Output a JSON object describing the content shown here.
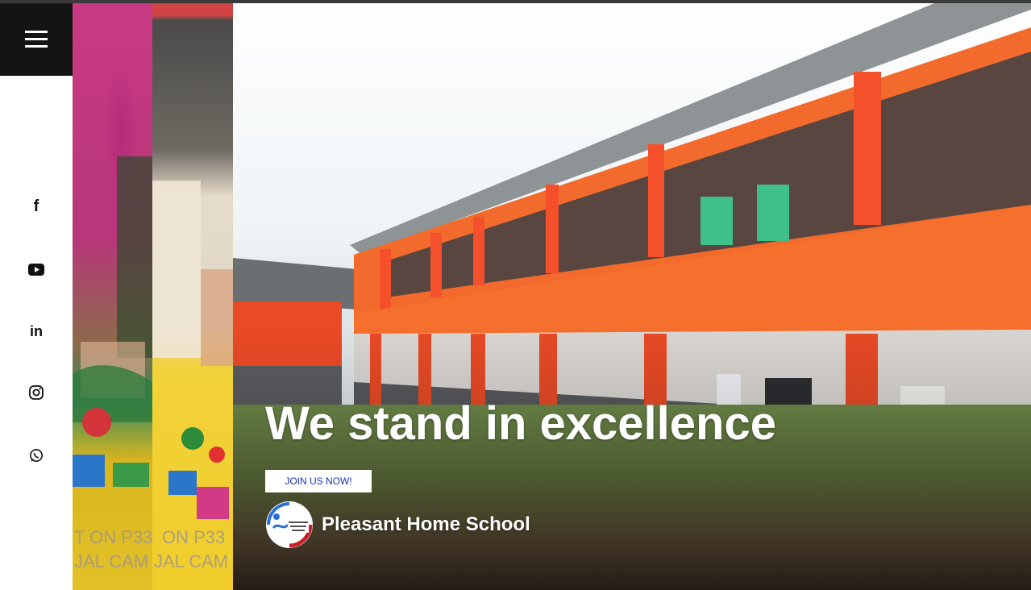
{
  "menu": {
    "icon": "hamburger-menu-icon"
  },
  "social": [
    {
      "name": "facebook",
      "icon": "facebook-icon",
      "glyph": "f"
    },
    {
      "name": "youtube",
      "icon": "youtube-icon"
    },
    {
      "name": "linkedin",
      "icon": "linkedin-icon",
      "glyph": "in"
    },
    {
      "name": "instagram",
      "icon": "instagram-icon"
    },
    {
      "name": "whatsapp",
      "icon": "whatsapp-icon"
    }
  ],
  "hero": {
    "title": "We stand in excellence",
    "cta_label": "JOIN US NOW!",
    "school_name": "Pleasant Home School",
    "logo_text": "PLEASANT HOME SCHOOL"
  },
  "background_text": {
    "strip1_line1": "T ON P33",
    "strip1_line2": "JAL CAM",
    "strip2_line1": "ON P33",
    "strip2_line2": "JAL CAM"
  },
  "colors": {
    "building_orange": "#f0692a",
    "building_red": "#e8402a",
    "cta_text": "#1b2fb8",
    "menu_bg": "#141414"
  }
}
